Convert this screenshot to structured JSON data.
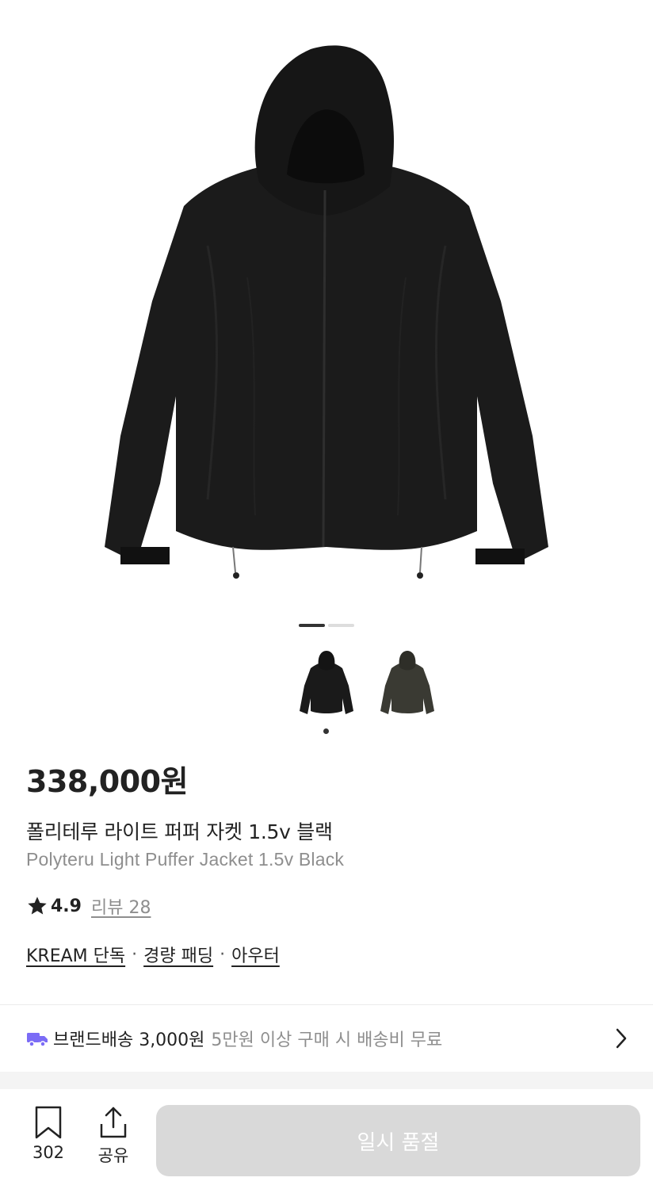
{
  "gallery": {
    "thumbnails": [
      {
        "name": "black",
        "color": "#1a1a1a"
      },
      {
        "name": "dark-olive",
        "color": "#3a3a33"
      }
    ]
  },
  "product": {
    "price": "338,000원",
    "name_ko": "폴리테루 라이트 퍼퍼 자켓 1.5v 블랙",
    "name_en": "Polyteru Light Puffer Jacket 1.5v Black",
    "rating": "4.9",
    "reviews_label": "리뷰 28",
    "tags": [
      "KREAM 단독",
      "경량 패딩",
      "아우터"
    ],
    "tag_separator": "·"
  },
  "shipping": {
    "label": "브랜드배송 3,000원",
    "note": "5만원 이상 구매 시 배송비 무료",
    "icon": "truck-icon",
    "accent": "#7b6cf6"
  },
  "bottom_bar": {
    "save_count": "302",
    "share_label": "공유",
    "cta_label": "일시 품절"
  },
  "colors": {
    "text": "#222222",
    "muted": "#8e8e8e",
    "cta_disabled": "#d9d9d9"
  }
}
